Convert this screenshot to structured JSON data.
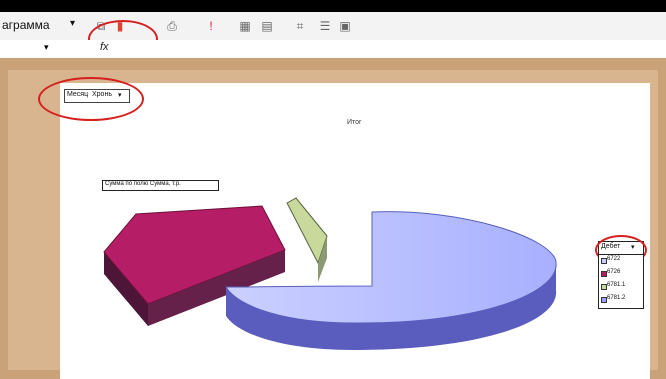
{
  "toolbar": {
    "menu_label": "аграмма",
    "menu_arrow": "▾",
    "icons": [
      "copy-icon",
      "chart-wizard-icon",
      "format-icon",
      "alert-icon",
      "grid-icon",
      "table-icon",
      "format-options-icon",
      "field-settings-icon",
      "field-list-icon"
    ]
  },
  "formula_bar": {
    "fx": "fx",
    "arrow": "▾"
  },
  "chart": {
    "page_field": {
      "left": "Месяц",
      "right": "Хронь",
      "arrow": "▾"
    },
    "title": "Итог",
    "data_field_label": "Сумма по полю Сумма, т.р.",
    "legend_field": {
      "label": "Дебет",
      "arrow": "▾"
    },
    "legend_items": [
      {
        "label": "6722",
        "color": "#c8ccff"
      },
      {
        "label": "6726",
        "color": "#b51d66"
      },
      {
        "label": "6781.1",
        "color": "#c9d89b"
      },
      {
        "label": "6781.2",
        "color": "#9aa0ff"
      }
    ]
  },
  "chart_data": {
    "type": "pie",
    "title": "Итог",
    "series": [
      {
        "name": "6722",
        "value": 64
      },
      {
        "name": "6726",
        "value": 33
      },
      {
        "name": "6781.1",
        "value": 3
      }
    ]
  }
}
